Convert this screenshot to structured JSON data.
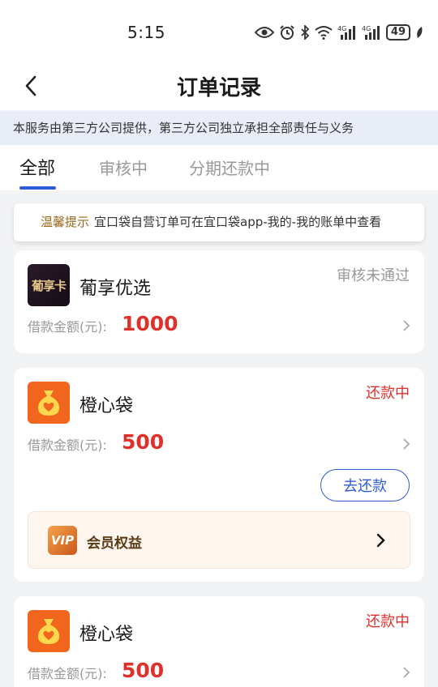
{
  "status_bar": {
    "time": "5:15",
    "battery": "49"
  },
  "header": {
    "title": "订单记录"
  },
  "notice": {
    "text": "本服务由第三方公司提供，第三方公司独立承担全部责任与义务"
  },
  "tabs": [
    {
      "label": "全部",
      "active": true
    },
    {
      "label": "审核中",
      "active": false
    },
    {
      "label": "分期还款中",
      "active": false
    }
  ],
  "tip": {
    "label": "温馨提示",
    "text": "宜口袋自营订单可在宜口袋app-我的-我的账单中查看"
  },
  "orders": [
    {
      "logo_text": "葡享卡",
      "name": "葡享优选",
      "status": "审核未通过",
      "amount_label": "借款金额(元):",
      "amount": "1000"
    },
    {
      "name": "橙心袋",
      "status": "还款中",
      "amount_label": "借款金额(元):",
      "amount": "500",
      "action_label": "去还款",
      "vip_logo_text": "VIP",
      "vip_label": "会员权益"
    },
    {
      "name": "橙心袋",
      "status": "还款中",
      "amount_label": "借款金额(元):",
      "amount": "500"
    }
  ],
  "colors": {
    "accent": "#2f5bd8",
    "red": "#e0302b",
    "bag_orange": "#f2651c"
  }
}
